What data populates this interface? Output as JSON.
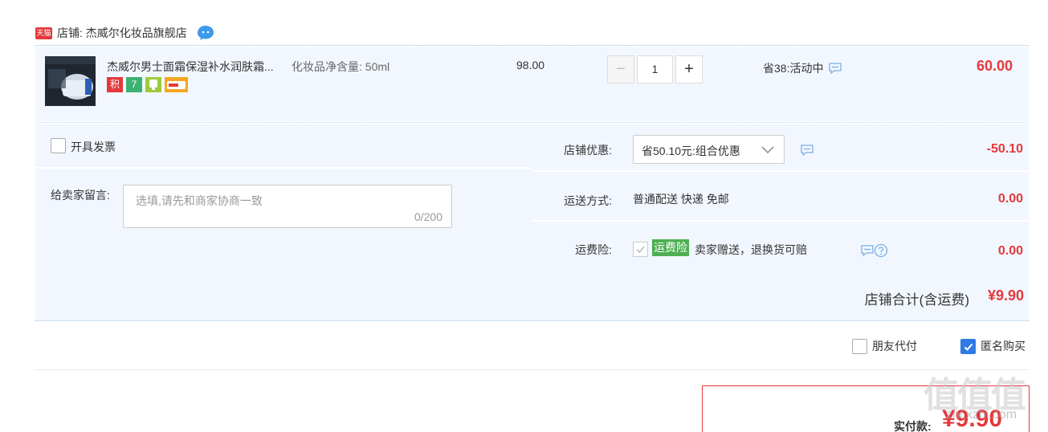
{
  "shop": {
    "tmall_badge": "天猫",
    "label": "店铺: 杰威尔化妆品旗舰店",
    "icon": "wangwang-chat-icon"
  },
  "item": {
    "title": "杰威尔男士面霜保湿补水润肤霜...",
    "spec": "化妆品净含量: 50ml",
    "unit_price": "98.00",
    "quantity": "1",
    "minus_label": "−",
    "plus_label": "+",
    "discount_note": "省38:活动中",
    "total": "60.00",
    "service_icons": [
      {
        "name": "points-icon",
        "text": "积",
        "color": "#e4393c"
      },
      {
        "name": "seven-day-return-icon",
        "text": "7",
        "color": "#3cb371"
      },
      {
        "name": "guarantee-icon",
        "text": "",
        "color": "#9ccc3c"
      },
      {
        "name": "card-icon",
        "text": "",
        "color": "#f5a623"
      }
    ]
  },
  "options": {
    "invoice_label": "开具发票",
    "message_label": "给卖家留言:",
    "message_placeholder": "选填,请先和商家协商一致",
    "message_count": "0/200",
    "shop_discount_label": "店铺优惠:",
    "shop_discount_value": "省50.10元:组合优惠",
    "shop_discount_amount": "-50.10",
    "shipping_label": "运送方式:",
    "shipping_value": "普通配送 快递 免邮",
    "shipping_amount": "0.00",
    "insurance_label": "运费险:",
    "insurance_tag": "运费险",
    "insurance_text": "卖家赠送，退换货可赔",
    "insurance_amount": "0.00",
    "subtotal_label": "店铺合计(含运费)",
    "subtotal_value": "¥9.90"
  },
  "payment": {
    "friend_pay_label": "朋友代付",
    "friend_pay_checked": false,
    "anonymous_label": "匿名购买",
    "anonymous_checked": true,
    "actual_label": "实付款:",
    "actual_value": "¥9.90"
  },
  "watermark": {
    "main": "值值值",
    "sub": "zhi.xzhi.com"
  },
  "colors": {
    "accent_red": "#e4393c",
    "panel_bg": "#f2f7ff",
    "checkbox_blue": "#2e7be5",
    "insurance_green": "#4caf50"
  }
}
